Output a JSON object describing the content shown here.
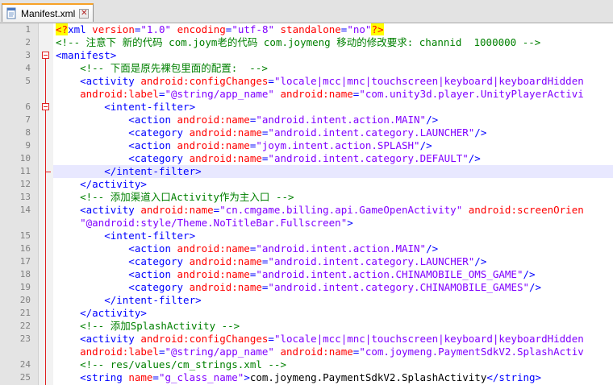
{
  "tab": {
    "label": "Manifest.xml",
    "icon": "xml-file-icon",
    "close_symbol": "✕"
  },
  "colors": {
    "tag": "#0000ff",
    "attr": "#ff0000",
    "value": "#8000ff",
    "comment": "#008000",
    "text": "#000000",
    "current_line": "#e8e8ff",
    "fold_marker": "#e02020"
  },
  "editor": {
    "current_line": 11,
    "lines": [
      {
        "n": "1",
        "fold": "",
        "tokens": [
          [
            "pi",
            "<?"
          ],
          [
            "tag",
            "xml "
          ],
          [
            "attr",
            "version"
          ],
          [
            "tag",
            "="
          ],
          [
            "val",
            "\"1.0\""
          ],
          [
            "tag",
            " "
          ],
          [
            "attr",
            "encoding"
          ],
          [
            "tag",
            "="
          ],
          [
            "val",
            "\"utf-8\""
          ],
          [
            "tag",
            " "
          ],
          [
            "attr",
            "standalone"
          ],
          [
            "tag",
            "="
          ],
          [
            "val",
            "\"no\""
          ],
          [
            "pi",
            "?>"
          ]
        ]
      },
      {
        "n": "2",
        "fold": "",
        "tokens": [
          [
            "cmt",
            "<!-- 注意下 新的代码 com.joym老的代码 com.joymeng 移动的修改要求: channid  1000000 -->"
          ]
        ]
      },
      {
        "n": "3",
        "fold": "start",
        "tokens": [
          [
            "tag",
            "<manifest>"
          ]
        ]
      },
      {
        "n": "4",
        "fold": "",
        "tokens": [
          [
            "cmt",
            "    <!-- 下面是原先裸包里面的配置:  -->"
          ]
        ]
      },
      {
        "n": "5",
        "fold": "",
        "tokens": [
          [
            "tag",
            "    <activity "
          ],
          [
            "attr",
            "android:configChanges"
          ],
          [
            "tag",
            "="
          ],
          [
            "val",
            "\"locale|mcc|mnc|touchscreen|keyboard|keyboardHidden"
          ]
        ]
      },
      {
        "n": "",
        "fold": "",
        "tokens": [
          [
            "tag",
            "    "
          ],
          [
            "attr",
            "android:label"
          ],
          [
            "tag",
            "="
          ],
          [
            "val",
            "\"@string/app_name\""
          ],
          [
            "tag",
            " "
          ],
          [
            "attr",
            "android:name"
          ],
          [
            "tag",
            "="
          ],
          [
            "val",
            "\"com.unity3d.player.UnityPlayerActivi"
          ]
        ]
      },
      {
        "n": "6",
        "fold": "start",
        "tokens": [
          [
            "tag",
            "        <intent-filter>"
          ]
        ]
      },
      {
        "n": "7",
        "fold": "",
        "tokens": [
          [
            "tag",
            "            <action "
          ],
          [
            "attr",
            "android:name"
          ],
          [
            "tag",
            "="
          ],
          [
            "val",
            "\"android.intent.action.MAIN\""
          ],
          [
            "tag",
            "/>"
          ]
        ]
      },
      {
        "n": "8",
        "fold": "",
        "tokens": [
          [
            "tag",
            "            <category "
          ],
          [
            "attr",
            "android:name"
          ],
          [
            "tag",
            "="
          ],
          [
            "val",
            "\"android.intent.category.LAUNCHER\""
          ],
          [
            "tag",
            "/>"
          ]
        ]
      },
      {
        "n": "9",
        "fold": "",
        "tokens": [
          [
            "tag",
            "            <action "
          ],
          [
            "attr",
            "android:name"
          ],
          [
            "tag",
            "="
          ],
          [
            "val",
            "\"joym.intent.action.SPLASH\""
          ],
          [
            "tag",
            "/>"
          ]
        ]
      },
      {
        "n": "10",
        "fold": "",
        "tokens": [
          [
            "tag",
            "            <category "
          ],
          [
            "attr",
            "android:name"
          ],
          [
            "tag",
            "="
          ],
          [
            "val",
            "\"android.intent.category.DEFAULT\""
          ],
          [
            "tag",
            "/>"
          ]
        ]
      },
      {
        "n": "11",
        "fold": "end",
        "tokens": [
          [
            "tag",
            "        </intent-filter>"
          ]
        ]
      },
      {
        "n": "12",
        "fold": "",
        "tokens": [
          [
            "tag",
            "    </activity>"
          ]
        ]
      },
      {
        "n": "13",
        "fold": "",
        "tokens": [
          [
            "cmt",
            "    <!-- 添加渠道入口Activity作为主入口 -->"
          ]
        ]
      },
      {
        "n": "14",
        "fold": "",
        "tokens": [
          [
            "tag",
            "    <activity "
          ],
          [
            "attr",
            "android:name"
          ],
          [
            "tag",
            "="
          ],
          [
            "val",
            "\"cn.cmgame.billing.api.GameOpenActivity\""
          ],
          [
            "tag",
            " "
          ],
          [
            "attr",
            "android:screenOrien"
          ]
        ]
      },
      {
        "n": "",
        "fold": "",
        "tokens": [
          [
            "val",
            "    \"@android:style/Theme.NoTitleBar.Fullscreen\""
          ],
          [
            "tag",
            ">"
          ]
        ]
      },
      {
        "n": "15",
        "fold": "",
        "tokens": [
          [
            "tag",
            "        <intent-filter>"
          ]
        ]
      },
      {
        "n": "16",
        "fold": "",
        "tokens": [
          [
            "tag",
            "            <action "
          ],
          [
            "attr",
            "android:name"
          ],
          [
            "tag",
            "="
          ],
          [
            "val",
            "\"android.intent.action.MAIN\""
          ],
          [
            "tag",
            "/>"
          ]
        ]
      },
      {
        "n": "17",
        "fold": "",
        "tokens": [
          [
            "tag",
            "            <category "
          ],
          [
            "attr",
            "android:name"
          ],
          [
            "tag",
            "="
          ],
          [
            "val",
            "\"android.intent.category.LAUNCHER\""
          ],
          [
            "tag",
            "/>"
          ]
        ]
      },
      {
        "n": "18",
        "fold": "",
        "tokens": [
          [
            "tag",
            "            <action "
          ],
          [
            "attr",
            "android:name"
          ],
          [
            "tag",
            "="
          ],
          [
            "val",
            "\"android.intent.action.CHINAMOBILE_OMS_GAME\""
          ],
          [
            "tag",
            "/>"
          ]
        ]
      },
      {
        "n": "19",
        "fold": "",
        "tokens": [
          [
            "tag",
            "            <category "
          ],
          [
            "attr",
            "android:name"
          ],
          [
            "tag",
            "="
          ],
          [
            "val",
            "\"android.intent.category.CHINAMOBILE_GAMES\""
          ],
          [
            "tag",
            "/>"
          ]
        ]
      },
      {
        "n": "20",
        "fold": "",
        "tokens": [
          [
            "tag",
            "        </intent-filter>"
          ]
        ]
      },
      {
        "n": "21",
        "fold": "",
        "tokens": [
          [
            "tag",
            "    </activity>"
          ]
        ]
      },
      {
        "n": "22",
        "fold": "",
        "tokens": [
          [
            "cmt",
            "    <!-- 添加SplashActivity -->"
          ]
        ]
      },
      {
        "n": "23",
        "fold": "",
        "tokens": [
          [
            "tag",
            "    <activity "
          ],
          [
            "attr",
            "android:configChanges"
          ],
          [
            "tag",
            "="
          ],
          [
            "val",
            "\"locale|mcc|mnc|touchscreen|keyboard|keyboardHidden"
          ]
        ]
      },
      {
        "n": "",
        "fold": "",
        "tokens": [
          [
            "tag",
            "    "
          ],
          [
            "attr",
            "android:label"
          ],
          [
            "tag",
            "="
          ],
          [
            "val",
            "\"@string/app_name\""
          ],
          [
            "tag",
            " "
          ],
          [
            "attr",
            "android:name"
          ],
          [
            "tag",
            "="
          ],
          [
            "val",
            "\"com.joymeng.PaymentSdkV2.SplashActiv"
          ]
        ]
      },
      {
        "n": "24",
        "fold": "",
        "tokens": [
          [
            "cmt",
            "    <!-- res/values/cm_strings.xml -->"
          ]
        ]
      },
      {
        "n": "25",
        "fold": "",
        "tokens": [
          [
            "tag",
            "    <string "
          ],
          [
            "attr",
            "name"
          ],
          [
            "tag",
            "="
          ],
          [
            "val",
            "\"g_class_name\""
          ],
          [
            "tag",
            ">"
          ],
          [
            "txt",
            "com.joymeng.PaymentSdkV2.SplashActivity"
          ],
          [
            "tag",
            "</string>"
          ]
        ]
      }
    ]
  }
}
